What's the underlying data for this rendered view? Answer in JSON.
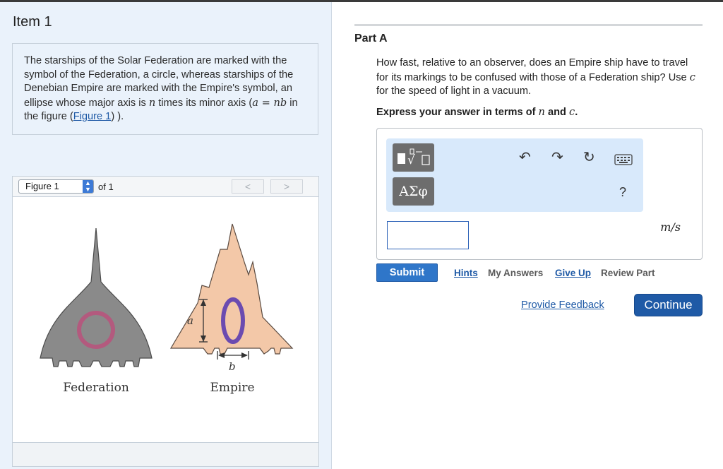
{
  "item": {
    "title": "Item 1"
  },
  "problem": {
    "text_before_n": "The starships of the Solar Federation are marked with the symbol of the Federation, a circle, whereas starships of the Denebian Empire are marked with the Empire's symbol, an ellipse whose major axis is ",
    "var_n": "n",
    "text_after_n": " times its minor axis (",
    "math_relation": "a = nb",
    "text_in_figure": " in the figure (",
    "figure_link": "Figure 1",
    "text_end": ") )."
  },
  "figure": {
    "selector_value": "Figure 1",
    "of_label": "of 1",
    "prev_label": "<",
    "next_label": ">",
    "federation_label": "Federation",
    "empire_label": "Empire",
    "label_a": "a",
    "label_b": "b",
    "colors": {
      "federation_body": "#8a8a8a",
      "federation_circle": "#b35a7e",
      "empire_body": "#f3c8a8",
      "empire_ellipse": "#6b4bb0"
    }
  },
  "part": {
    "title": "Part A",
    "question_pre": "How fast, relative to an observer, does an Empire ship have to travel for its markings to be confused with those of a Federation ship? Use ",
    "question_var_c": "c",
    "question_post": " for the speed of light in a vacuum.",
    "express_pre": "Express your answer in terms of ",
    "express_var_n": "n",
    "express_and": " and ",
    "express_var_c": "c",
    "express_end": "."
  },
  "answer": {
    "template_button_icon": "math-template-icon",
    "greek_button_label": "ΑΣφ",
    "help_label": "?",
    "units": "m/s",
    "input_value": ""
  },
  "actions": {
    "submit": "Submit",
    "hints": "Hints",
    "my_answers": "My Answers",
    "give_up": "Give Up",
    "review_part": "Review Part",
    "provide_feedback": "Provide Feedback",
    "continue": "Continue"
  }
}
